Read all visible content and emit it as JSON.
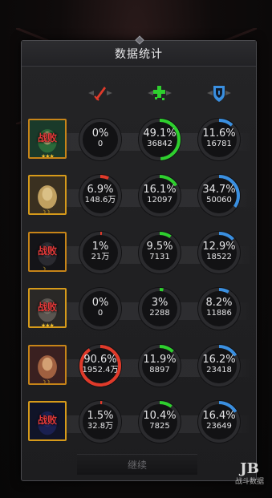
{
  "window": {
    "title": "数据统计"
  },
  "columns": [
    {
      "icon": "damage-sword-icon",
      "color": "#e03a2a"
    },
    {
      "icon": "heal-cross-icon",
      "color": "#2ecf2e"
    },
    {
      "icon": "shield-icon",
      "color": "#3a8fe0"
    }
  ],
  "heroes": [
    {
      "defeated": true,
      "status_label": "战败",
      "stars": "★★★",
      "stats": [
        {
          "percent": "0%",
          "value": "0",
          "fraction": 0.0
        },
        {
          "percent": "49.1%",
          "value": "36842",
          "fraction": 0.491
        },
        {
          "percent": "11.6%",
          "value": "16781",
          "fraction": 0.116
        }
      ]
    },
    {
      "defeated": false,
      "status_label": "",
      "stars": "☽☽",
      "stats": [
        {
          "percent": "6.9%",
          "value": "148.6万",
          "fraction": 0.069
        },
        {
          "percent": "16.1%",
          "value": "12097",
          "fraction": 0.161
        },
        {
          "percent": "34.7%",
          "value": "50060",
          "fraction": 0.347
        }
      ]
    },
    {
      "defeated": true,
      "status_label": "战败",
      "stars": "☽",
      "stats": [
        {
          "percent": "1%",
          "value": "21万",
          "fraction": 0.01
        },
        {
          "percent": "9.5%",
          "value": "7131",
          "fraction": 0.095
        },
        {
          "percent": "12.9%",
          "value": "18522",
          "fraction": 0.129
        }
      ]
    },
    {
      "defeated": true,
      "status_label": "战败",
      "stars": "★★★",
      "stats": [
        {
          "percent": "0%",
          "value": "0",
          "fraction": 0.0
        },
        {
          "percent": "3%",
          "value": "2288",
          "fraction": 0.03
        },
        {
          "percent": "8.2%",
          "value": "11886",
          "fraction": 0.082
        }
      ]
    },
    {
      "defeated": false,
      "status_label": "",
      "stars": "☽☽",
      "stats": [
        {
          "percent": "90.6%",
          "value": "1952.4万",
          "fraction": 0.906
        },
        {
          "percent": "11.9%",
          "value": "8897",
          "fraction": 0.119
        },
        {
          "percent": "16.2%",
          "value": "23418",
          "fraction": 0.162
        }
      ]
    },
    {
      "defeated": true,
      "status_label": "战败",
      "stars": "",
      "stats": [
        {
          "percent": "1.5%",
          "value": "32.8万",
          "fraction": 0.015
        },
        {
          "percent": "10.4%",
          "value": "7825",
          "fraction": 0.104
        },
        {
          "percent": "16.4%",
          "value": "23649",
          "fraction": 0.164
        }
      ]
    }
  ],
  "footer": {
    "continue_label": "继续"
  },
  "watermark": {
    "logo": "JB",
    "text": "战斗数据"
  }
}
